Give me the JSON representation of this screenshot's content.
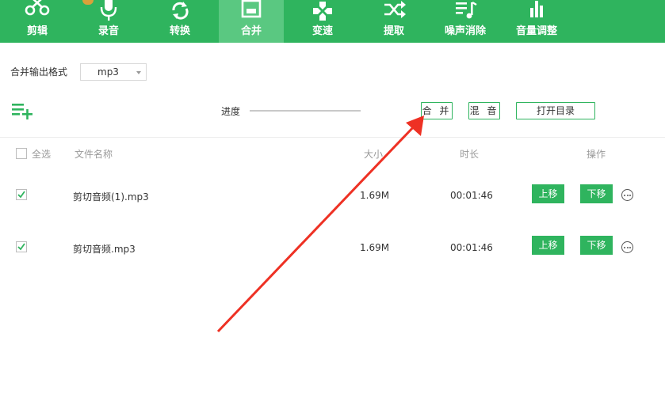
{
  "toolbar": {
    "items": [
      {
        "label": "剪辑",
        "icon": "scissors-icon",
        "active": false
      },
      {
        "label": "录音",
        "icon": "microphone-icon",
        "active": false
      },
      {
        "label": "转换",
        "icon": "convert-icon",
        "active": false
      },
      {
        "label": "合并",
        "icon": "merge-icon",
        "active": true
      },
      {
        "label": "变速",
        "icon": "speed-icon",
        "active": false
      },
      {
        "label": "提取",
        "icon": "shuffle-icon",
        "active": false
      },
      {
        "label": "噪声消除",
        "icon": "noise-removal-icon",
        "active": false
      },
      {
        "label": "音量调整",
        "icon": "volume-bars-icon",
        "active": false
      }
    ],
    "accent": "#2fb45e"
  },
  "format": {
    "label": "合并输出格式",
    "selected": "mp3"
  },
  "actions": {
    "progress_label": "进度",
    "merge": "合 并",
    "mix": "混 音",
    "open_dir": "打开目录"
  },
  "table": {
    "headers": {
      "select_all": "全选",
      "name": "文件名称",
      "size": "大小",
      "duration": "时长",
      "ops": "操作"
    },
    "rows": [
      {
        "checked": true,
        "name": "剪切音频(1).mp3",
        "size": "1.69M",
        "duration": "00:01:46",
        "up": "上移",
        "down": "下移"
      },
      {
        "checked": true,
        "name": "剪切音频.mp3",
        "size": "1.69M",
        "duration": "00:01:46",
        "up": "上移",
        "down": "下移"
      }
    ]
  }
}
